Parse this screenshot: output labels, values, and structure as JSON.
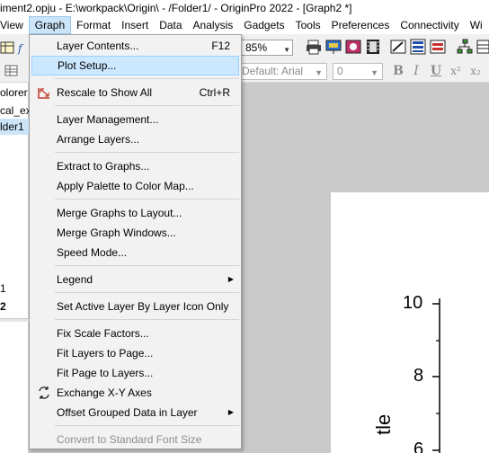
{
  "window": {
    "title": "iment2.opju - E:\\workpack\\Origin\\ - /Folder1/ - OriginPro 2022 - [Graph2 *]"
  },
  "menubar": {
    "items": [
      "View",
      "Graph",
      "Format",
      "Insert",
      "Data",
      "Analysis",
      "Gadgets",
      "Tools",
      "Preferences",
      "Connectivity",
      "Wi"
    ],
    "active": "Graph"
  },
  "toolbar": {
    "zoom": "85%",
    "font": "Default: Arial",
    "size": "0",
    "bold": "B",
    "italic": "I",
    "underline": "U",
    "superscript": "x²",
    "subscript": "x₂"
  },
  "left_panel": {
    "rows": [
      "olorer (",
      "cal_ex",
      "lder1",
      "1",
      "2"
    ],
    "selected": "lder1"
  },
  "graph_menu": {
    "items": [
      {
        "label": "Layer Contents...",
        "shortcut": "F12",
        "icon": "none"
      },
      {
        "label": "Plot Setup...",
        "shortcut": "",
        "icon": "none",
        "highlighted": true
      },
      {
        "label": "Rescale to Show All",
        "shortcut": "Ctrl+R",
        "icon": "rescale-icon"
      },
      {
        "label": "Layer Management...",
        "shortcut": ""
      },
      {
        "label": "Arrange Layers...",
        "shortcut": ""
      },
      {
        "label": "Extract to Graphs...",
        "shortcut": ""
      },
      {
        "label": "Apply Palette to Color Map...",
        "shortcut": ""
      },
      {
        "label": "Merge Graphs to Layout...",
        "shortcut": ""
      },
      {
        "label": "Merge Graph Windows...",
        "shortcut": ""
      },
      {
        "label": "Speed Mode...",
        "shortcut": ""
      },
      {
        "label": "Legend",
        "shortcut": "",
        "submenu": true
      },
      {
        "label": "Set Active Layer By Layer Icon Only",
        "shortcut": ""
      },
      {
        "label": "Fix Scale Factors...",
        "shortcut": ""
      },
      {
        "label": "Fit Layers to Page...",
        "shortcut": ""
      },
      {
        "label": "Fit Page to Layers...",
        "shortcut": ""
      },
      {
        "label": "Exchange X-Y Axes",
        "shortcut": "",
        "icon": "exchange-axes-icon"
      },
      {
        "label": "Offset Grouped Data in Layer",
        "shortcut": "",
        "submenu": true
      },
      {
        "label": "Convert to Standard Font Size",
        "shortcut": "",
        "disabled": true
      }
    ]
  },
  "graph_page": {
    "yaxis_ticks": [
      "10",
      "8",
      "6"
    ],
    "yaxis_title_fragment": "tle"
  },
  "colors": {
    "menu_highlight": "#cce8ff",
    "workspace": "#c9c9c9",
    "menubar_active": "#cce4f7"
  }
}
